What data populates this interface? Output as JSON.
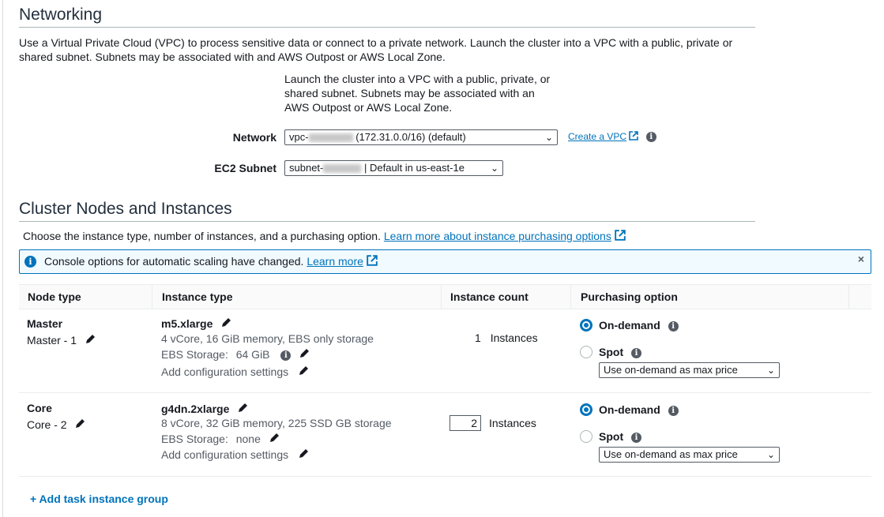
{
  "networking": {
    "title": "Networking",
    "description": "Use a Virtual Private Cloud (VPC) to process sensitive data or connect to a private network. Launch the cluster into a VPC with a public, private or shared subnet. Subnets may be associated with and AWS Outpost or AWS Local Zone.",
    "help_line1": "Launch the cluster into a VPC with a public, private, or",
    "help_line2": "shared subnet. Subnets may be associated with an",
    "help_line3": "AWS Outpost or AWS Local Zone.",
    "network_label": "Network",
    "network_prefix": "vpc-",
    "network_suffix": "(172.31.0.0/16) (default)",
    "create_vpc_link": "Create a VPC",
    "subnet_label": "EC2 Subnet",
    "subnet_prefix": "subnet-",
    "subnet_suffix": "| Default in us-east-1e"
  },
  "cluster": {
    "title": "Cluster Nodes and Instances",
    "description": "Choose the instance type, number of instances, and a purchasing option.",
    "learn_link": "Learn more about instance purchasing options",
    "banner_text": "Console options for automatic scaling have changed.",
    "banner_link": "Learn more",
    "banner_close": "×",
    "columns": [
      "Node type",
      "Instance type",
      "Instance count",
      "Purchasing option"
    ],
    "rows": [
      {
        "node_type": "Master",
        "node_name": "Master - 1",
        "instance_type": "m5.xlarge",
        "specs": "4 vCore, 16 GiB memory, EBS only storage",
        "ebs_label": "EBS Storage:",
        "ebs_value": "64 GiB",
        "config_link": "Add configuration settings",
        "count": "1",
        "count_unit": "Instances",
        "ondemand_label": "On-demand",
        "spot_label": "Spot",
        "price_option": "Use on-demand as max price"
      },
      {
        "node_type": "Core",
        "node_name": "Core - 2",
        "instance_type": "g4dn.2xlarge",
        "specs": "8 vCore, 32 GiB memory, 225 SSD GB storage",
        "ebs_label": "EBS Storage:",
        "ebs_value": "none",
        "config_link": "Add configuration settings",
        "count": "2",
        "count_unit": "Instances",
        "ondemand_label": "On-demand",
        "spot_label": "Spot",
        "price_option": "Use on-demand as max price"
      }
    ],
    "add_task_group": "+ Add task instance group"
  },
  "colors": {
    "link": "#0073bb",
    "radio_selected": "#0073bb",
    "banner_bg": "#f1faff"
  }
}
